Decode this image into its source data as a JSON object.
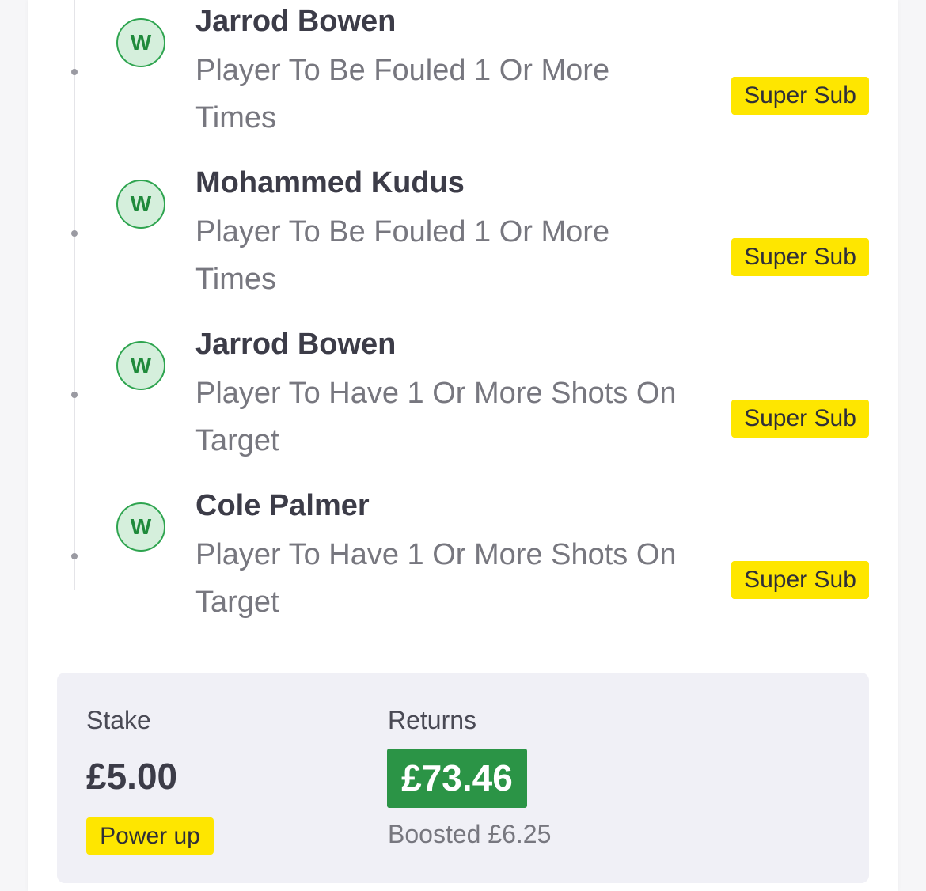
{
  "legs": [
    {
      "result": "W",
      "player": "Jarrod Bowen",
      "market_line1": "Player To Be Fouled 1 Or More",
      "market_line2": "Times",
      "tag": "Super Sub"
    },
    {
      "result": "W",
      "player": "Mohammed Kudus",
      "market_line1": "Player To Be Fouled 1 Or More",
      "market_line2": "Times",
      "tag": "Super Sub"
    },
    {
      "result": "W",
      "player": "Jarrod Bowen",
      "market_line1": "Player To Have 1 Or More Shots On",
      "market_line2": "Target",
      "tag": "Super Sub"
    },
    {
      "result": "W",
      "player": "Cole Palmer",
      "market_line1": "Player To Have 1 Or More Shots On",
      "market_line2": "Target",
      "tag": "Super Sub"
    }
  ],
  "summary": {
    "stake_label": "Stake",
    "stake_value": "£5.00",
    "power_up_label": "Power up",
    "returns_label": "Returns",
    "returns_value": "£73.46",
    "boosted_text": "Boosted £6.25"
  },
  "colors": {
    "win_green": "#2ea44f",
    "returns_green": "#2b9446",
    "badge_yellow": "#fee600"
  }
}
